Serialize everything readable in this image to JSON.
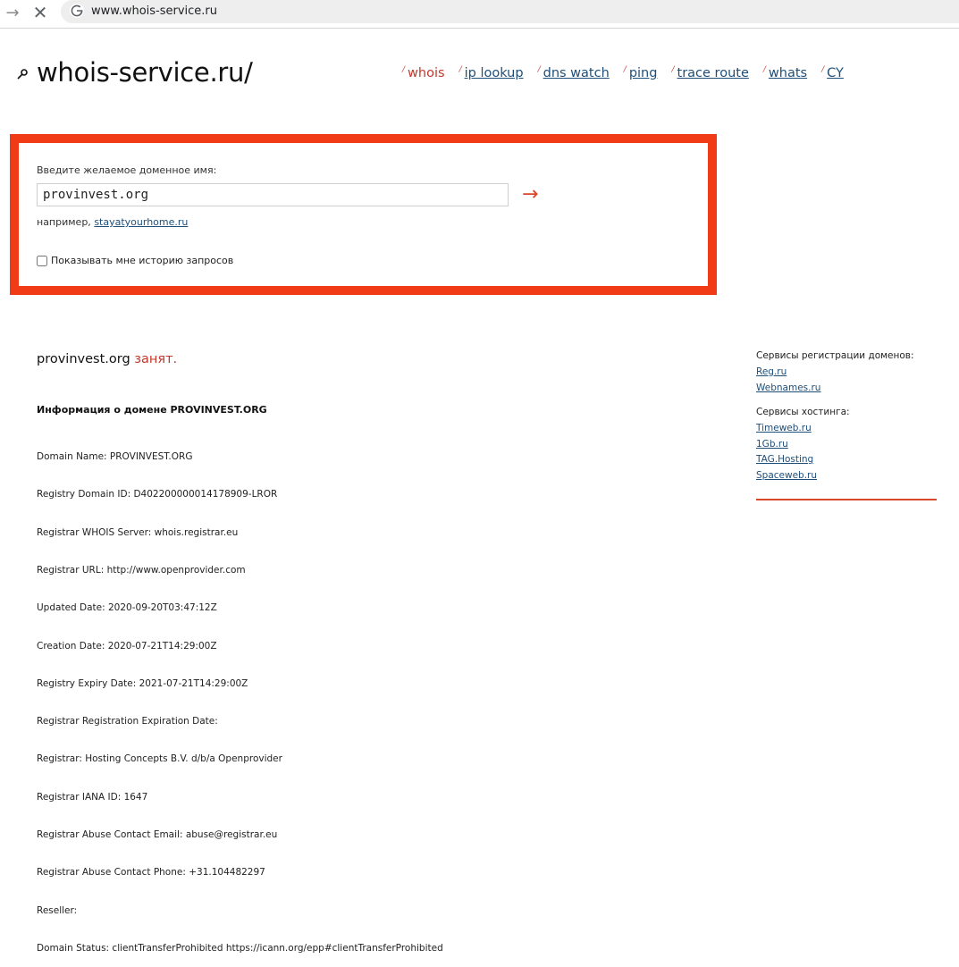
{
  "browser": {
    "url": "www.whois-service.ru",
    "back_icon": "arrow-left-icon",
    "stop_icon": "close-icon"
  },
  "header": {
    "logo": "whois-service.ru/",
    "nav": [
      {
        "label": "whois",
        "active": true
      },
      {
        "label": "ip lookup",
        "active": false
      },
      {
        "label": "dns watch",
        "active": false
      },
      {
        "label": "ping",
        "active": false
      },
      {
        "label": "trace route",
        "active": false
      },
      {
        "label": "whats",
        "active": false
      },
      {
        "label": "CY",
        "active": false
      }
    ]
  },
  "search": {
    "label": "Введите желаемое доменное имя:",
    "value": "provinvest.org",
    "submit_icon": "arrow-right-icon",
    "example_prefix": "например,",
    "example_link": "stayatyourhome.ru",
    "history_label": "Показывать мне историю запросов",
    "history_checked": false
  },
  "result": {
    "domain": "provinvest.org",
    "status": "занят.",
    "info_title": "Информация о домене PROVINVEST.ORG",
    "lines": [
      "Domain Name: PROVINVEST.ORG",
      "Registry Domain ID: D402200000014178909-LROR",
      "Registrar WHOIS Server: whois.registrar.eu",
      "Registrar URL: http://www.openprovider.com",
      "Updated Date: 2020-09-20T03:47:12Z",
      "Creation Date: 2020-07-21T14:29:00Z",
      "Registry Expiry Date: 2021-07-21T14:29:00Z",
      "Registrar Registration Expiration Date:",
      "Registrar: Hosting Concepts B.V. d/b/a Openprovider",
      "Registrar IANA ID: 1647",
      "Registrar Abuse Contact Email: abuse@registrar.eu",
      "Registrar Abuse Contact Phone: +31.104482297",
      "Reseller:",
      "Domain Status: clientTransferProhibited https://icann.org/epp#clientTransferProhibited"
    ]
  },
  "side": {
    "registrars_title": "Сервисы регистрации доменов:",
    "registrars": [
      "Reg.ru",
      "Webnames.ru"
    ],
    "hosting_title": "Сервисы хостинга:",
    "hosting": [
      "Timeweb.ru",
      "1Gb.ru",
      "TAG.Hosting",
      "Spaceweb.ru"
    ]
  },
  "colors": {
    "accent": "#f13a16",
    "link": "#1f4e79",
    "status": "#c0392b"
  }
}
